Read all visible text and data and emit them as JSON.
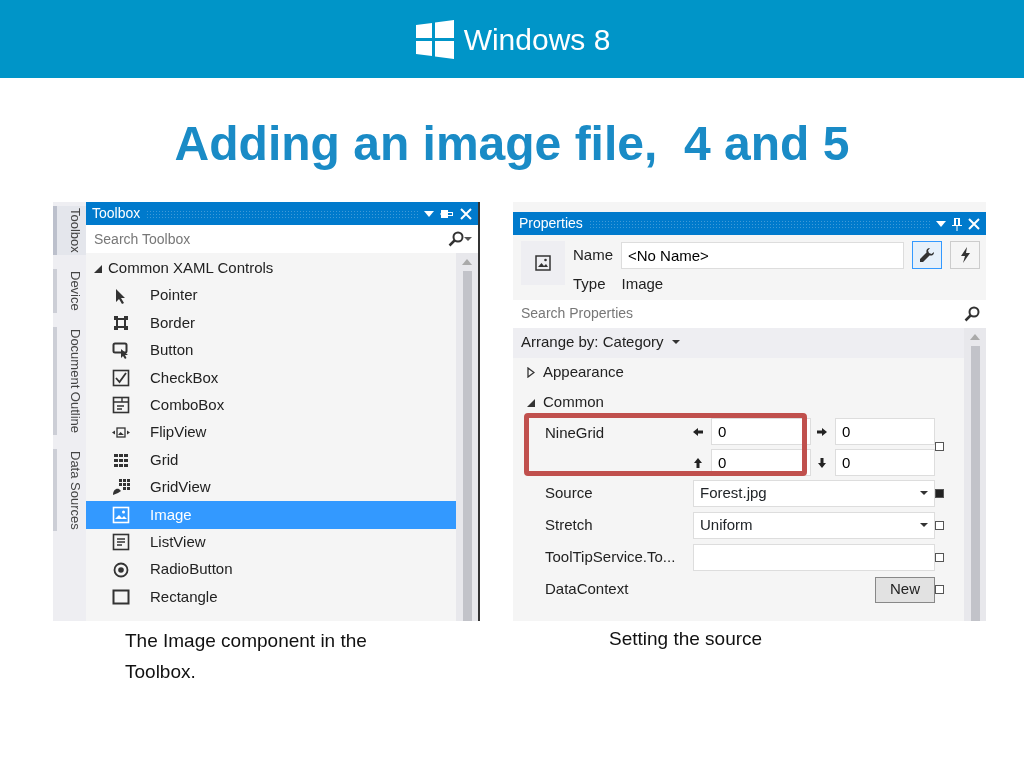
{
  "header": {
    "logo_text": "Windows 8"
  },
  "title": "Adding an image file,  4 and 5",
  "toolbox": {
    "side_tabs": [
      {
        "label": "Toolbox",
        "selected": true
      },
      {
        "label": "Device",
        "selected": false
      },
      {
        "label": "Document Outline",
        "selected": false
      },
      {
        "label": "Data Sources",
        "selected": false
      }
    ],
    "title": "Toolbox",
    "search": {
      "placeholder": "Search Toolbox"
    },
    "group": {
      "label": "Common XAML Controls",
      "expanded": true,
      "items": [
        {
          "label": "Pointer",
          "selected": false
        },
        {
          "label": "Border",
          "selected": false
        },
        {
          "label": "Button",
          "selected": false
        },
        {
          "label": "CheckBox",
          "selected": false
        },
        {
          "label": "ComboBox",
          "selected": false
        },
        {
          "label": "FlipView",
          "selected": false
        },
        {
          "label": "Grid",
          "selected": false
        },
        {
          "label": "GridView",
          "selected": false
        },
        {
          "label": "Image",
          "selected": true
        },
        {
          "label": "ListView",
          "selected": false
        },
        {
          "label": "RadioButton",
          "selected": false
        },
        {
          "label": "Rectangle",
          "selected": false
        }
      ]
    },
    "caption": "The Image component in the Toolbox."
  },
  "properties": {
    "title": "Properties",
    "name_label": "Name",
    "name_value": "<No Name>",
    "type_label": "Type",
    "type_value": "Image",
    "search": {
      "placeholder": "Search Properties"
    },
    "arrange_by": "Arrange by: Category",
    "categories": [
      {
        "label": "Appearance",
        "expanded": false
      },
      {
        "label": "Common",
        "expanded": true
      }
    ],
    "rows": [
      {
        "kind": "ninegrid",
        "label": "NineGrid",
        "values": [
          "0",
          "0",
          "0",
          "0"
        ],
        "set": false,
        "highlighted": true
      },
      {
        "kind": "dropdown",
        "label": "Source",
        "value": "Forest.jpg",
        "set": true
      },
      {
        "kind": "dropdown",
        "label": "Stretch",
        "value": "Uniform",
        "set": false
      },
      {
        "kind": "text",
        "label": "ToolTipService.To...",
        "set": false
      },
      {
        "kind": "button",
        "label": "DataContext",
        "button": "New",
        "set": false
      }
    ],
    "caption": "Setting the source"
  }
}
